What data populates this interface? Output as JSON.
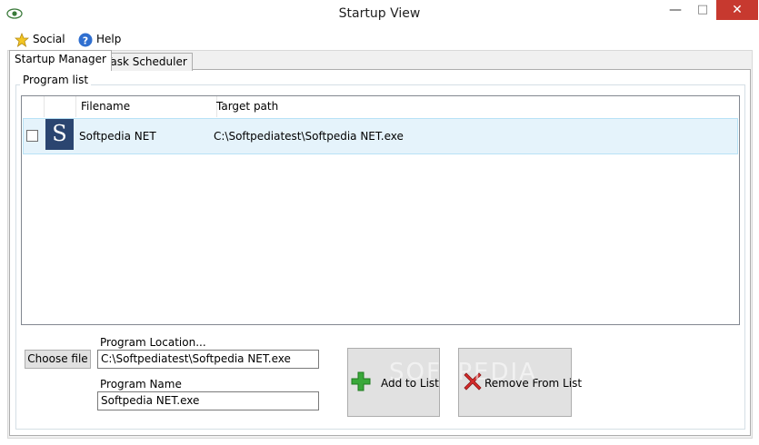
{
  "window": {
    "title": "Startup View"
  },
  "menu": {
    "social": "Social",
    "help": "Help"
  },
  "tabs": [
    {
      "label": "Startup Manager",
      "active": true
    },
    {
      "label": "Task Scheduler",
      "active": false
    }
  ],
  "program_list": {
    "group_label": "Program list",
    "columns": {
      "filename": "Filename",
      "target": "Target path"
    },
    "rows": [
      {
        "checked": false,
        "icon_letter": "S",
        "filename": "Softpedia NET",
        "target": "C:\\Softpediatest\\Softpedia NET.exe"
      }
    ]
  },
  "controls": {
    "choose_file": "Choose file",
    "location_label": "Program Location...",
    "location_value": "C:\\Softpediatest\\Softpedia NET.exe",
    "name_label": "Program Name",
    "name_value": "Softpedia NET.exe",
    "add_label": "Add to List",
    "remove_label": "Remove From List"
  },
  "watermark": "SOFTPEDIA",
  "colors": {
    "close": "#c7392f",
    "selection": "#e5f3fb",
    "app_icon_bg": "#2b4570",
    "add_green": "#3aa83a",
    "remove_red": "#d62b2b"
  }
}
